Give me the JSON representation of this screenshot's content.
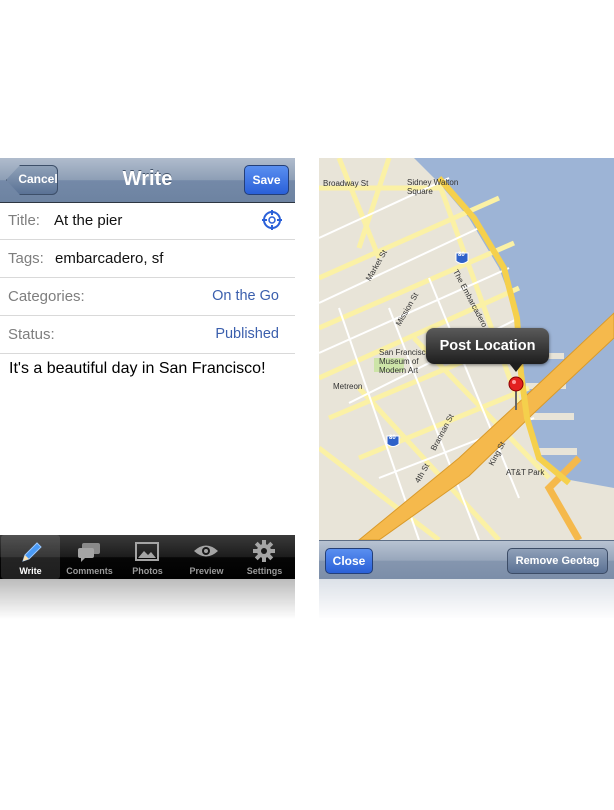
{
  "write_screen": {
    "nav": {
      "title": "Write",
      "cancel_label": "Cancel",
      "save_label": "Save"
    },
    "fields": {
      "title_label": "Title:",
      "title_value": "At the pier",
      "tags_label": "Tags:",
      "tags_value": "embarcadero, sf",
      "categories_label": "Categories:",
      "categories_value": "On the Go",
      "status_label": "Status:",
      "status_value": "Published"
    },
    "body": "It's a beautiful day in San Francisco!",
    "tabs": [
      {
        "label": "Write",
        "icon": "pencil-icon",
        "active": true
      },
      {
        "label": "Comments",
        "icon": "speech-bubbles-icon",
        "active": false
      },
      {
        "label": "Photos",
        "icon": "photo-icon",
        "active": false
      },
      {
        "label": "Preview",
        "icon": "eye-icon",
        "active": false
      },
      {
        "label": "Settings",
        "icon": "gear-icon",
        "active": false
      }
    ]
  },
  "map_screen": {
    "callout": "Post Location",
    "close_label": "Close",
    "remove_label": "Remove Geotag",
    "labels": {
      "broadway": "Broadway St",
      "sidney": "Sidney Walton Square",
      "embarcadero": "The Embarcadero",
      "market": "Market St",
      "mission": "Mission St",
      "museum": "San Francisco Museum of Modern Art",
      "metreon": "Metreon",
      "brannan": "Brannan St",
      "fourth": "4th St",
      "king": "King St",
      "att": "AT&T Park",
      "i80a": "80",
      "i80b": "80"
    }
  },
  "colors": {
    "link_blue": "#3b5fad",
    "accent_blue": "#2a60d8",
    "water": "#9db4d6",
    "highway": "#f5b94c"
  }
}
